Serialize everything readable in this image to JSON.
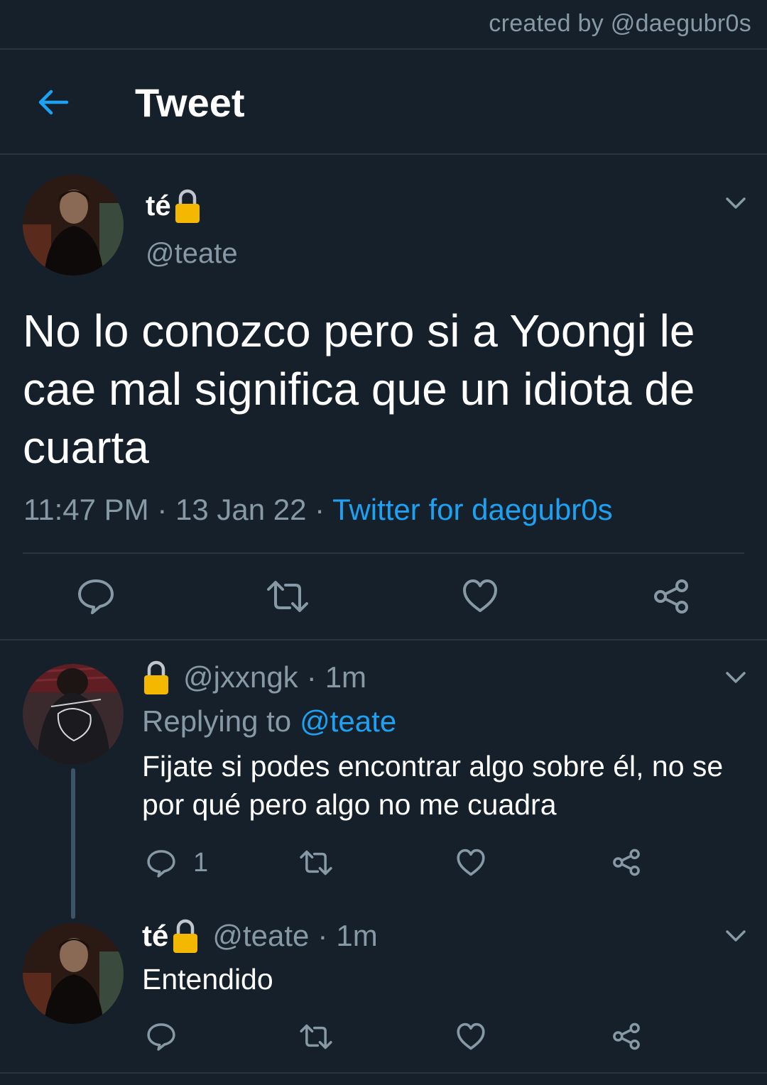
{
  "credit": "created by @daegubr0s",
  "header": {
    "title": "Tweet"
  },
  "main_tweet": {
    "name": "té",
    "handle": "@teate",
    "text": "No lo conozco pero si a Yoongi le cae mal significa que un idiota de cuarta",
    "time": "11:47 PM",
    "date": "13 Jan 22",
    "separator": "·",
    "client": "Twitter for daegubr0s"
  },
  "reply1": {
    "handle": "@jxxngk",
    "time": "1m",
    "separator": "·",
    "replying_prefix": "Replying to",
    "replying_to": "@teate",
    "text": "Fijate si podes encontrar algo sobre él, no se por qué pero algo no me cuadra",
    "reply_count": "1"
  },
  "reply2": {
    "name": "té",
    "handle": "@teate",
    "time": "1m",
    "separator": "·",
    "text": "Entendido"
  },
  "colors": {
    "background": "#15202b",
    "accent": "#1da1f2",
    "muted": "#8899a6",
    "divider": "#263441",
    "lock": "#f5b800"
  },
  "icons": [
    "back-arrow-icon",
    "chevron-down-icon",
    "lock-icon",
    "reply-icon",
    "retweet-icon",
    "like-icon",
    "share-icon"
  ]
}
